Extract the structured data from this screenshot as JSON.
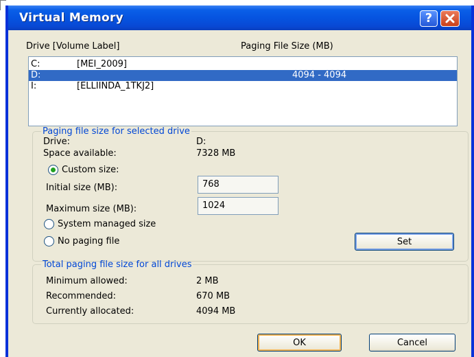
{
  "window": {
    "title": "Virtual Memory"
  },
  "drives": {
    "header_drive": "Drive  [Volume Label]",
    "header_size": "Paging File Size (MB)",
    "rows": [
      {
        "letter": "C:",
        "label": "[MEI_2009]",
        "size": ""
      },
      {
        "letter": "D:",
        "label": "",
        "size": "4094 - 4094"
      },
      {
        "letter": "I:",
        "label": "[ELLIINDA_1TKJ2]",
        "size": ""
      }
    ]
  },
  "selected": {
    "legend": "Paging file size for selected drive",
    "drive_label": "Drive:",
    "drive_value": "D:",
    "space_label": "Space available:",
    "space_value": "7328 MB",
    "custom_label": "Custom size:",
    "initial_label": "Initial size (MB):",
    "initial_value": "768",
    "max_label": "Maximum size (MB):",
    "max_value": "1024",
    "system_label": "System managed size",
    "nopaging_label": "No paging file",
    "set_label": "Set"
  },
  "totals": {
    "legend": "Total paging file size for all drives",
    "min_label": "Minimum allowed:",
    "min_value": "2 MB",
    "rec_label": "Recommended:",
    "rec_value": "670 MB",
    "cur_label": "Currently allocated:",
    "cur_value": "4094 MB"
  },
  "buttons": {
    "ok": "OK",
    "cancel": "Cancel"
  },
  "icons": {
    "help": "question-mark-icon",
    "close": "close-icon",
    "radio_selected": "radio-custom-size"
  },
  "colors": {
    "title_bar": "#0654e0",
    "selection": "#316ac5",
    "group_legend": "#0046d5",
    "close_button": "#c9401a"
  }
}
